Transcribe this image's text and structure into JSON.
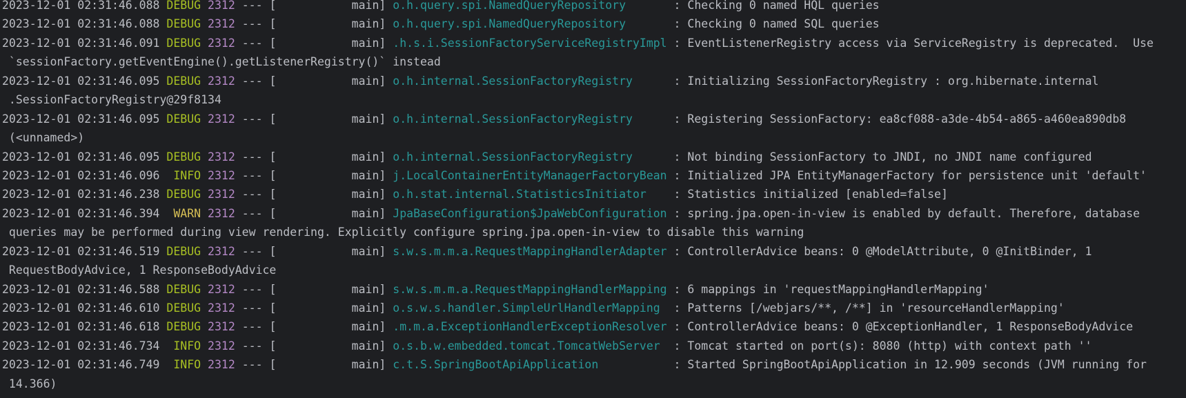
{
  "console": {
    "lines": [
      {
        "type": "log",
        "ts": "2023-12-01 02:31:46.088",
        "level": "DEBUG",
        "pid": "2312",
        "mid": " --- [           main] ",
        "logger": "o.h.query.spi.NamedQueryRepository      ",
        "msg": " : Checking 0 named HQL queries"
      },
      {
        "type": "log",
        "ts": "2023-12-01 02:31:46.088",
        "level": "DEBUG",
        "pid": "2312",
        "mid": " --- [           main] ",
        "logger": "o.h.query.spi.NamedQueryRepository      ",
        "msg": " : Checking 0 named SQL queries"
      },
      {
        "type": "log",
        "ts": "2023-12-01 02:31:46.091",
        "level": "DEBUG",
        "pid": "2312",
        "mid": " --- [           main] ",
        "logger": ".h.s.i.SessionFactoryServiceRegistryImpl",
        "msg": " : EventListenerRegistry access via ServiceRegistry is deprecated.  Use"
      },
      {
        "type": "cont",
        "text": " `sessionFactory.getEventEngine().getListenerRegistry()` instead"
      },
      {
        "type": "log",
        "ts": "2023-12-01 02:31:46.095",
        "level": "DEBUG",
        "pid": "2312",
        "mid": " --- [           main] ",
        "logger": "o.h.internal.SessionFactoryRegistry     ",
        "msg": " : Initializing SessionFactoryRegistry : org.hibernate.internal"
      },
      {
        "type": "cont",
        "text": " .SessionFactoryRegistry@29f8134"
      },
      {
        "type": "log",
        "ts": "2023-12-01 02:31:46.095",
        "level": "DEBUG",
        "pid": "2312",
        "mid": " --- [           main] ",
        "logger": "o.h.internal.SessionFactoryRegistry     ",
        "msg": " : Registering SessionFactory: ea8cf088-a3de-4b54-a865-a460ea890db8"
      },
      {
        "type": "cont",
        "text": " (<unnamed>)"
      },
      {
        "type": "log",
        "ts": "2023-12-01 02:31:46.095",
        "level": "DEBUG",
        "pid": "2312",
        "mid": " --- [           main] ",
        "logger": "o.h.internal.SessionFactoryRegistry     ",
        "msg": " : Not binding SessionFactory to JNDI, no JNDI name configured"
      },
      {
        "type": "log",
        "ts": "2023-12-01 02:31:46.096",
        "level": " INFO",
        "pid": "2312",
        "mid": " --- [           main] ",
        "logger": "j.LocalContainerEntityManagerFactoryBean",
        "msg": " : Initialized JPA EntityManagerFactory for persistence unit 'default'"
      },
      {
        "type": "log",
        "ts": "2023-12-01 02:31:46.238",
        "level": "DEBUG",
        "pid": "2312",
        "mid": " --- [           main] ",
        "logger": "o.h.stat.internal.StatisticsInitiator   ",
        "msg": " : Statistics initialized [enabled=false]"
      },
      {
        "type": "log",
        "ts": "2023-12-01 02:31:46.394",
        "level": " WARN",
        "pid": "2312",
        "mid": " --- [           main] ",
        "logger": "JpaBaseConfiguration$JpaWebConfiguration",
        "msg": " : spring.jpa.open-in-view is enabled by default. Therefore, database"
      },
      {
        "type": "cont",
        "text": " queries may be performed during view rendering. Explicitly configure spring.jpa.open-in-view to disable this warning"
      },
      {
        "type": "log",
        "ts": "2023-12-01 02:31:46.519",
        "level": "DEBUG",
        "pid": "2312",
        "mid": " --- [           main] ",
        "logger": "s.w.s.m.m.a.RequestMappingHandlerAdapter",
        "msg": " : ControllerAdvice beans: 0 @ModelAttribute, 0 @InitBinder, 1"
      },
      {
        "type": "cont",
        "text": " RequestBodyAdvice, 1 ResponseBodyAdvice"
      },
      {
        "type": "log",
        "ts": "2023-12-01 02:31:46.588",
        "level": "DEBUG",
        "pid": "2312",
        "mid": " --- [           main] ",
        "logger": "s.w.s.m.m.a.RequestMappingHandlerMapping",
        "msg": " : 6 mappings in 'requestMappingHandlerMapping'"
      },
      {
        "type": "log",
        "ts": "2023-12-01 02:31:46.610",
        "level": "DEBUG",
        "pid": "2312",
        "mid": " --- [           main] ",
        "logger": "o.s.w.s.handler.SimpleUrlHandlerMapping ",
        "msg": " : Patterns [/webjars/**, /**] in 'resourceHandlerMapping'"
      },
      {
        "type": "log",
        "ts": "2023-12-01 02:31:46.618",
        "level": "DEBUG",
        "pid": "2312",
        "mid": " --- [           main] ",
        "logger": ".m.m.a.ExceptionHandlerExceptionResolver",
        "msg": " : ControllerAdvice beans: 0 @ExceptionHandler, 1 ResponseBodyAdvice"
      },
      {
        "type": "log",
        "ts": "2023-12-01 02:31:46.734",
        "level": " INFO",
        "pid": "2312",
        "mid": " --- [           main] ",
        "logger": "o.s.b.w.embedded.tomcat.TomcatWebServer ",
        "msg": " : Tomcat started on port(s): 8080 (http) with context path ''"
      },
      {
        "type": "log",
        "ts": "2023-12-01 02:31:46.749",
        "level": " INFO",
        "pid": "2312",
        "mid": " --- [           main] ",
        "logger": "c.t.S.SpringBootApiApplication          ",
        "msg": " : Started SpringBootApiApplication in 12.909 seconds (JVM running for"
      },
      {
        "type": "cont",
        "text": " 14.366)"
      }
    ]
  }
}
